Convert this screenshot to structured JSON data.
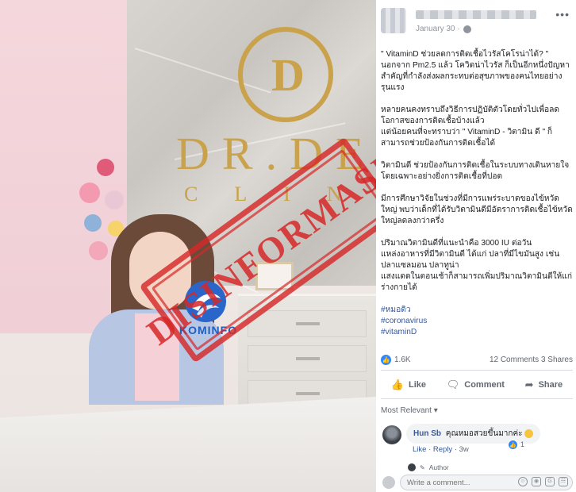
{
  "photo": {
    "brand_main": "DR.DE",
    "brand_sub": "CLINI",
    "logo_letter": "D",
    "stamp_text": "DISINFORMASI",
    "watermark_text": "KOMINFO",
    "stamp_color": "#d62828",
    "brand_color": "#c9a24b"
  },
  "post": {
    "header": {
      "date": "January 30 ·",
      "more_icon": "more-horizontal-icon",
      "privacy_icon": "globe-icon"
    },
    "paragraphs": [
      "\" VitaminD ช่วยลดการติดเชื้อไวรัสโคโรน่าได้? \"\nนอกจาก Pm2.5 แล้ว โควิดน่าไวรัส ก็เป็นอีกหนึ่งปัญหาสำคัญที่กำลังส่งผลกระทบต่อสุขภาพของคนไทยอย่างรุนแรง",
      "หลายคนคงทราบถึงวิธีการปฏิบัติตัวโดยทั่วไปเพื่อลดโอกาสของการติดเชื้อบ้างแล้ว\nแต่น้อยคนที่จะทราบว่า \" VitaminD - วิตามิน ดี \" ก็สามารถช่วยป้องกันการติดเชื้อได้",
      "วิตามินดี ช่วยป้องกันการติดเชื้อในระบบทางเดินหายใจโดยเฉพาะอย่างยิ่งการติดเชื้อที่ปอด",
      "มีการศึกษาวิจัยในช่วงที่มีการแพร่ระบาดของไข้หวัดใหญ่ พบว่าเด็กที่ได้รับวิตามินดีมีอัตราการติดเชื้อไข้หวัดใหญ่ลดลงกว่าครึ่ง",
      "ปริมาณวิตามินดีที่แนะนำคือ 3000 IU ต่อวัน\nแหล่งอาหารที่มีวิตามินดี ได้แก่ ปลาที่มีไขมันสูง เช่น ปลาแซลมอน ปลาทูน่า\nแสงแดดในตอนเช้าก็สามารถเพิ่มปริมาณวิตามินดีให้แก่ร่างกายได้"
    ],
    "hashtags": [
      "#หมอดิว",
      "#coronavirus",
      "#vitaminD"
    ]
  },
  "reactions": {
    "like_count": "1.6K",
    "comments": "12 Comments",
    "shares": "3 Shares"
  },
  "actions": {
    "like": "Like",
    "comment": "Comment",
    "share": "Share"
  },
  "comments_section": {
    "sort_label": "Most Relevant ▾",
    "items": [
      {
        "name": "Hun Sb",
        "text": "คุณหมอสวยขึ้นมากค่ะ",
        "like_label": "Like",
        "reply_label": "Reply",
        "time": "3w",
        "likes": "1"
      }
    ],
    "reply_author_label": "Author",
    "write_placeholder": "Write a comment..."
  }
}
